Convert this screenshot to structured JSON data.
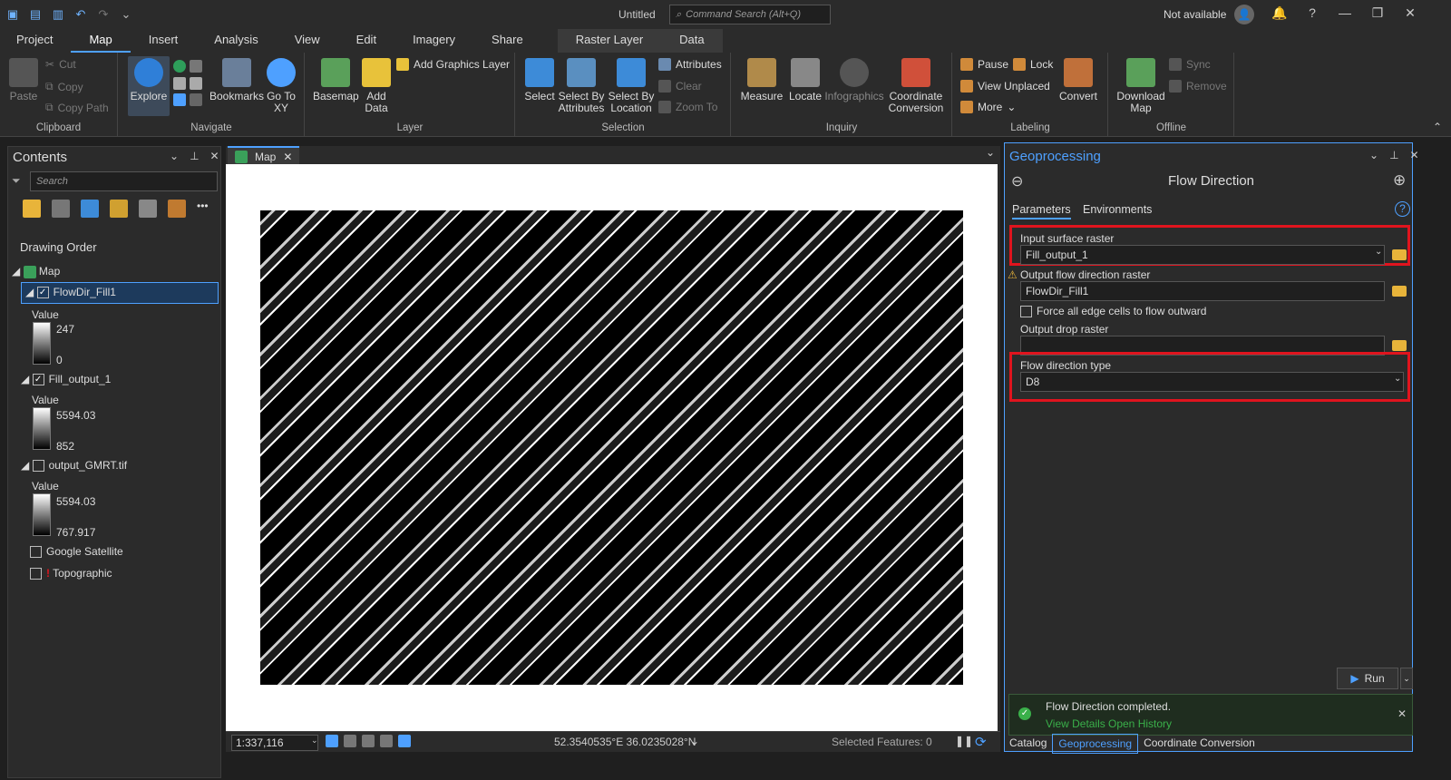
{
  "app": {
    "title": "Untitled",
    "command_search_placeholder": "Command Search (Alt+Q)",
    "account": "Not available"
  },
  "menu": {
    "tabs": [
      "Project",
      "Map",
      "Insert",
      "Analysis",
      "View",
      "Edit",
      "Imagery",
      "Share",
      "Raster Layer",
      "Data"
    ],
    "active": "Map"
  },
  "ribbon": {
    "clipboard": {
      "paste": "Paste",
      "cut": "Cut",
      "copy": "Copy",
      "copy_path": "Copy Path",
      "label": "Clipboard"
    },
    "navigate": {
      "explore": "Explore",
      "bookmarks": "Bookmarks",
      "go_to_xy": "Go To XY",
      "label": "Navigate"
    },
    "layer": {
      "basemap": "Basemap",
      "add_data": "Add Data",
      "add_graphics_layer": "Add Graphics Layer",
      "label": "Layer"
    },
    "selection": {
      "select": "Select",
      "select_by_attributes": "Select By Attributes",
      "select_by_location": "Select By Location",
      "attributes": "Attributes",
      "clear": "Clear",
      "zoom_to": "Zoom To",
      "label": "Selection"
    },
    "inquiry": {
      "measure": "Measure",
      "locate": "Locate",
      "infographics": "Infographics",
      "coordinate_conversion": "Coordinate Conversion",
      "label": "Inquiry"
    },
    "labeling": {
      "pause": "Pause",
      "lock": "Lock",
      "view_unplaced": "View Unplaced",
      "more": "More",
      "convert": "Convert",
      "label": "Labeling"
    },
    "offline": {
      "download_map": "Download Map",
      "sync": "Sync",
      "remove": "Remove",
      "label": "Offline"
    }
  },
  "contents": {
    "title": "Contents",
    "search_placeholder": "Search",
    "drawing_order": "Drawing Order",
    "map_name": "Map",
    "layers": [
      {
        "name": "FlowDir_Fill1",
        "checked": true,
        "value_label": "Value",
        "max": "247",
        "min": "0"
      },
      {
        "name": "Fill_output_1",
        "checked": true,
        "value_label": "Value",
        "max": "5594.03",
        "min": "852"
      },
      {
        "name": "output_GMRT.tif",
        "checked": false,
        "value_label": "Value",
        "max": "5594.03",
        "min": "767.917"
      }
    ],
    "basemaps": [
      "Google Satellite",
      "Topographic"
    ]
  },
  "map": {
    "tab": "Map",
    "scale": "1:337,116",
    "coordinates": "52.3540535°E 36.0235028°N",
    "selected_features": "Selected Features: 0"
  },
  "geoprocessing": {
    "title": "Geoprocessing",
    "tool": "Flow Direction",
    "tabs": [
      "Parameters",
      "Environments"
    ],
    "input_label": "Input surface raster",
    "input_value": "Fill_output_1",
    "output_label": "Output flow direction raster",
    "output_value": "FlowDir_Fill1",
    "force_edge": "Force all edge cells to flow outward",
    "drop_label": "Output drop raster",
    "drop_value": "",
    "type_label": "Flow direction type",
    "type_value": "D8",
    "run": "Run",
    "message": "Flow Direction completed.",
    "view_details": "View Details",
    "open_history": "Open History"
  },
  "bottom_tabs": [
    "Catalog",
    "Geoprocessing",
    "Coordinate Conversion"
  ],
  "colors": {
    "accent": "#4ea0ff",
    "highlight": "#e0141e",
    "background": "#1f1f1f"
  }
}
